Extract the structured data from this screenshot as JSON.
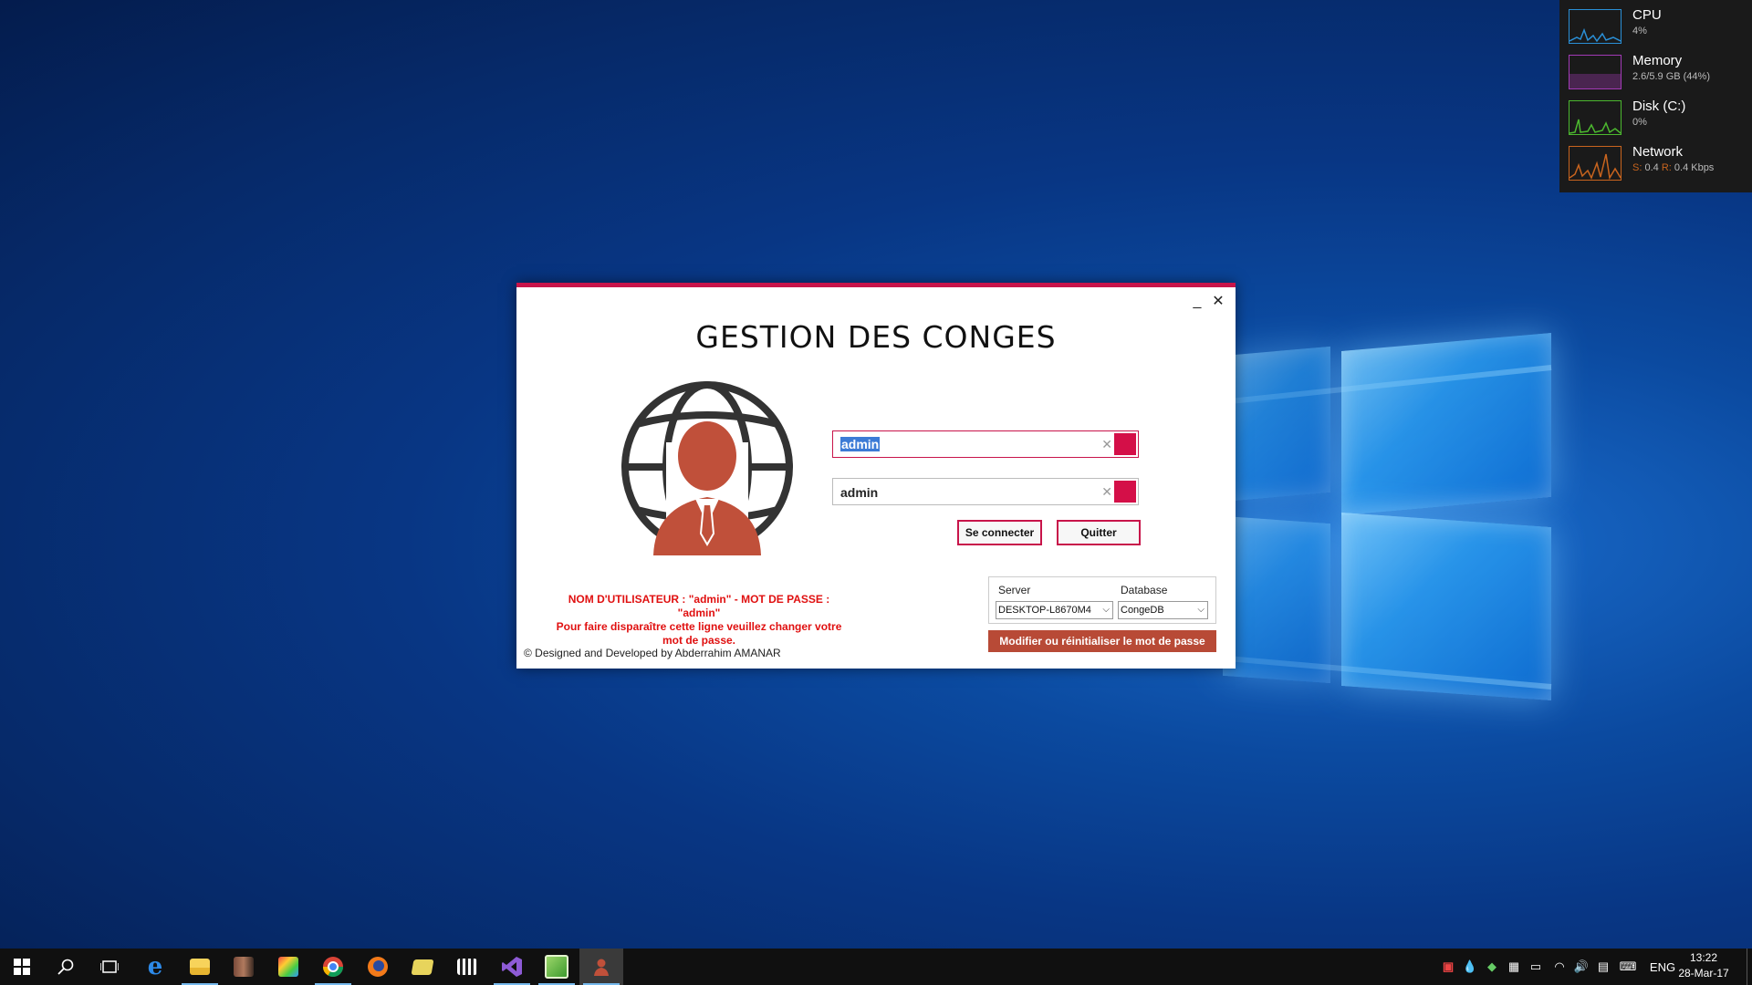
{
  "perf_widget": {
    "items": [
      {
        "name": "CPU",
        "value": "4%",
        "color": "#2a8fd6"
      },
      {
        "name": "Memory",
        "value": "2.6/5.9 GB (44%)",
        "color": "#a23ab6"
      },
      {
        "name": "Disk (C:)",
        "value": "0%",
        "color": "#4cb82f"
      },
      {
        "name": "Network",
        "value_s_label": "S:",
        "value_s": "0.4",
        "value_r_label": "R:",
        "value_r": "0.4 Kbps",
        "color": "#c8641e"
      }
    ]
  },
  "dialog": {
    "title": "GESTION DES CONGES",
    "minimize_icon": "minimize-icon",
    "close_icon": "close-icon",
    "username_value": "admin",
    "password_value": "admin",
    "connect_label": "Se connecter",
    "quit_label": "Quitter",
    "hint_line1": "NOM D'UTILISATEUR : \"admin\" - MOT DE PASSE : \"admin\"",
    "hint_line2": "Pour faire disparaître cette ligne veuillez changer votre mot de passe.",
    "footer": "© Designed and Developed by Abderrahim AMANAR",
    "server_label": "Server",
    "server_value": "DESKTOP-L8670M4",
    "database_label": "Database",
    "database_value": "CongeDB",
    "reset_label": "Modifier ou réinitialiser le mot de passe",
    "accent_color": "#c8144a",
    "logo_color": "#c0503a"
  },
  "taskbar": {
    "icons": [
      "start-icon",
      "search-icon",
      "task-view-icon",
      "edge-icon",
      "file-explorer-icon",
      "app-icon",
      "paint-icon",
      "chrome-icon",
      "firefox-icon",
      "folder-icon",
      "video-editor-icon",
      "visual-studio-icon",
      "notepad-icon",
      "gestion-conges-icon"
    ],
    "language": "ENG",
    "time": "13:22",
    "date": "28-Mar-17"
  }
}
